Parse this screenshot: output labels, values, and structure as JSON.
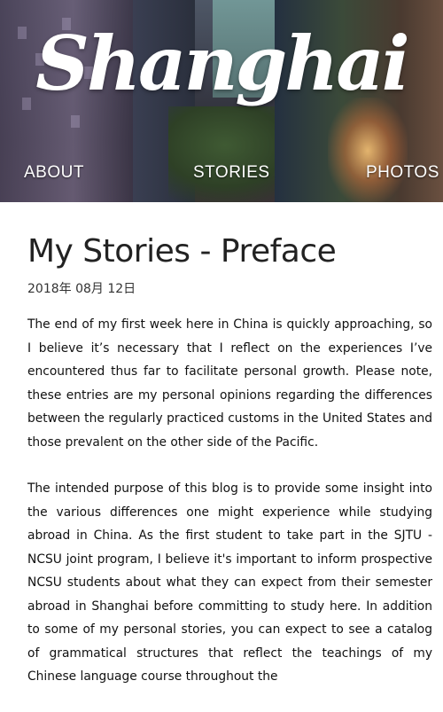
{
  "header": {
    "logo_text": "Shanghai",
    "nav": {
      "about": "ABOUT",
      "stories": "STORIES",
      "photos": "PHOTOS"
    }
  },
  "post": {
    "title": "My Stories - Preface",
    "date": "2018年 08月 12日",
    "paragraphs": [
      "The end of my first week here in China is quickly approaching, so I believe it’s necessary that I reflect on the experiences I’ve encountered thus far to facilitate personal growth. Please note, these entries are my personal opinions regarding the differences between the regularly practiced customs in the United States and those prevalent on the other side of the Pacific.",
      "The intended purpose of this blog is to provide some insight into the various differences one might experience while studying abroad in China. As the first student to take part in the SJTU - NCSU joint program, I believe it's important to inform prospective NCSU students about what they can expect from their semester abroad in Shanghai before committing to study here. In addition to some of my personal stories, you can expect to see a catalog of grammatical structures that reflect the teachings of my Chinese language course throughout the"
    ]
  },
  "colors": {
    "page_background": "#ffffff",
    "header_text": "#ffffff",
    "body_text": "#111111"
  }
}
